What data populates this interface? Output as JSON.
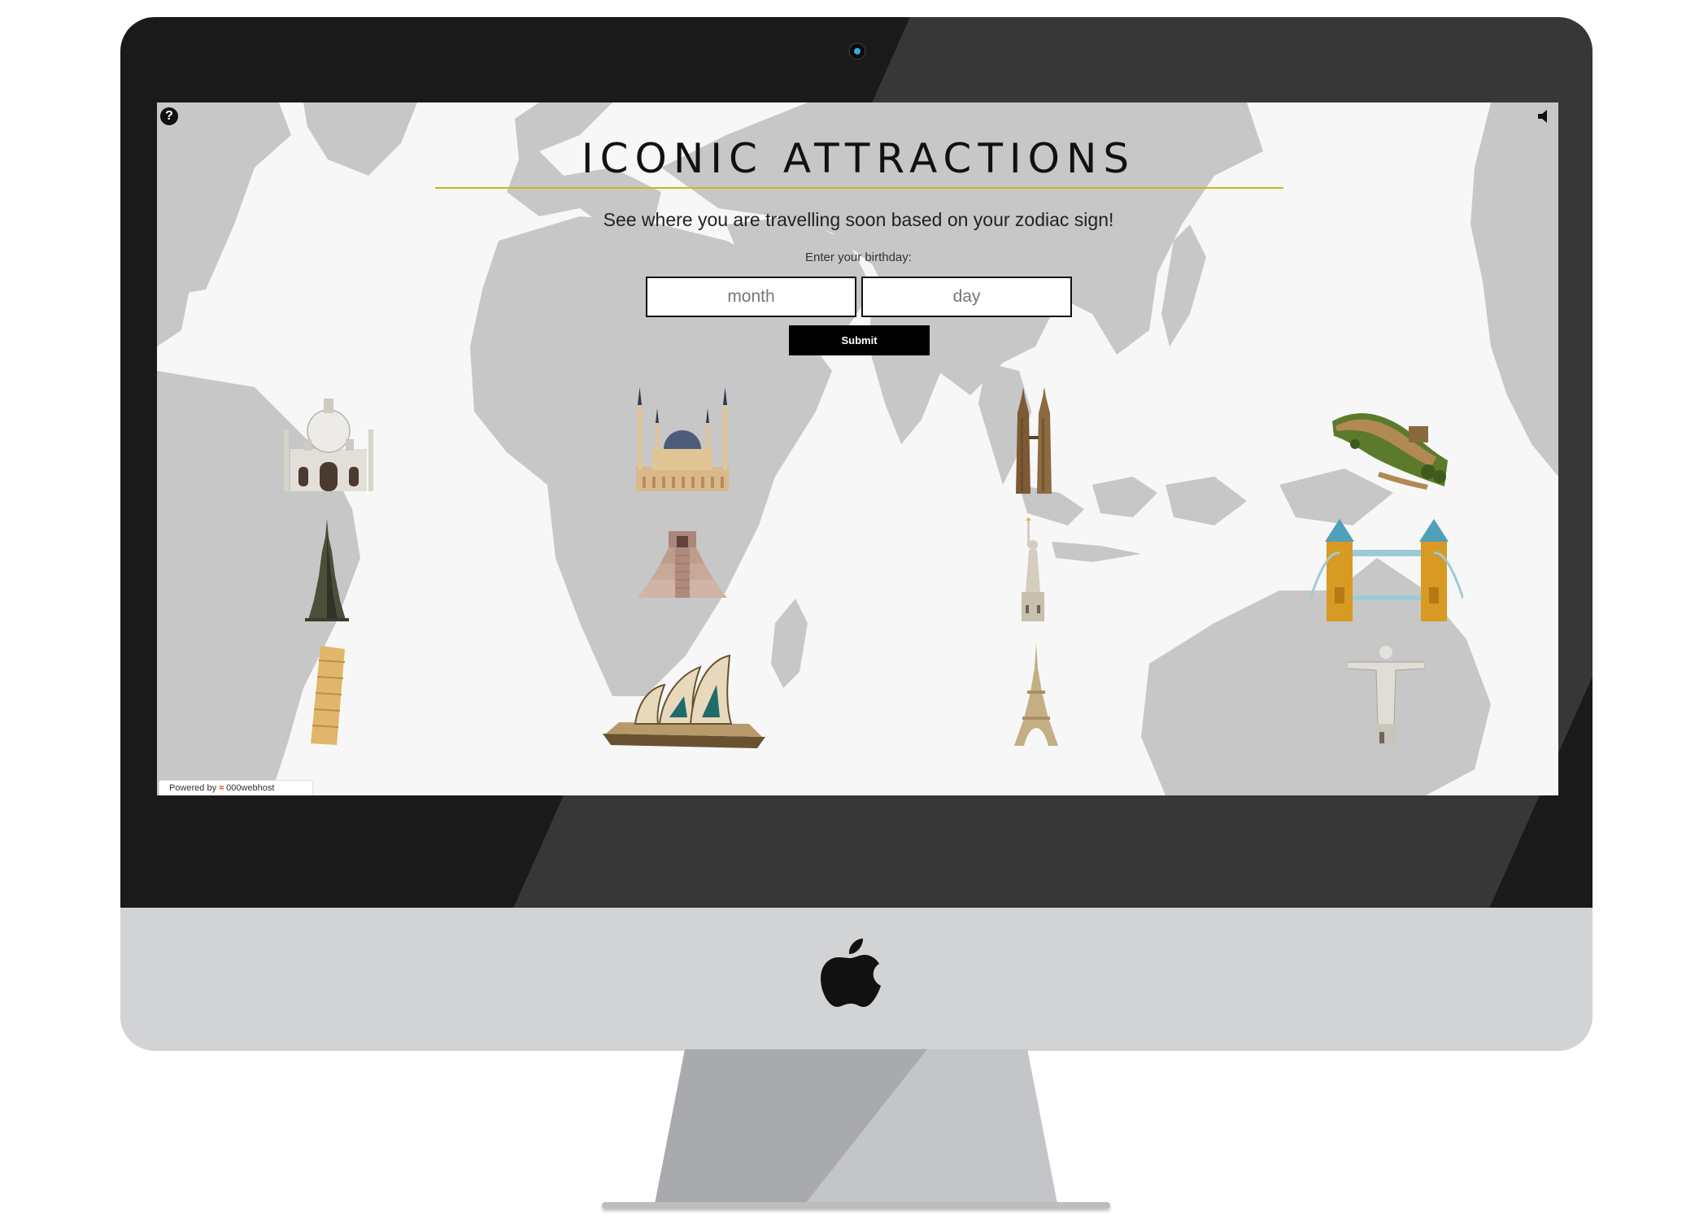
{
  "page": {
    "title": "ICONIC ATTRACTIONS",
    "subtitle": "See where you are travelling soon based on your zodiac sign!",
    "birthday_label": "Enter your birthday:"
  },
  "form": {
    "month_placeholder": "month",
    "day_placeholder": "day",
    "submit_label": "Submit"
  },
  "controls": {
    "help_icon": "question-circle-icon",
    "help_glyph": "?",
    "sound_icon": "speaker-icon"
  },
  "footer": {
    "powered_by": "Powered by",
    "host": "000webhost"
  },
  "landmarks": [
    "taj-mahal",
    "blue-mosque",
    "petronas-towers",
    "great-wall",
    "burj-khalifa",
    "chichen-itza",
    "statue-of-liberty",
    "tower-bridge",
    "leaning-tower-of-pisa",
    "sydney-opera-house",
    "eiffel-tower",
    "christ-the-redeemer"
  ],
  "colors": {
    "title_rule": "#c9b823",
    "map_land": "#c7c7c7",
    "map_sea": "#f7f7f7",
    "bezel": "#1a1a1a",
    "chin": "#d2d3d5"
  }
}
